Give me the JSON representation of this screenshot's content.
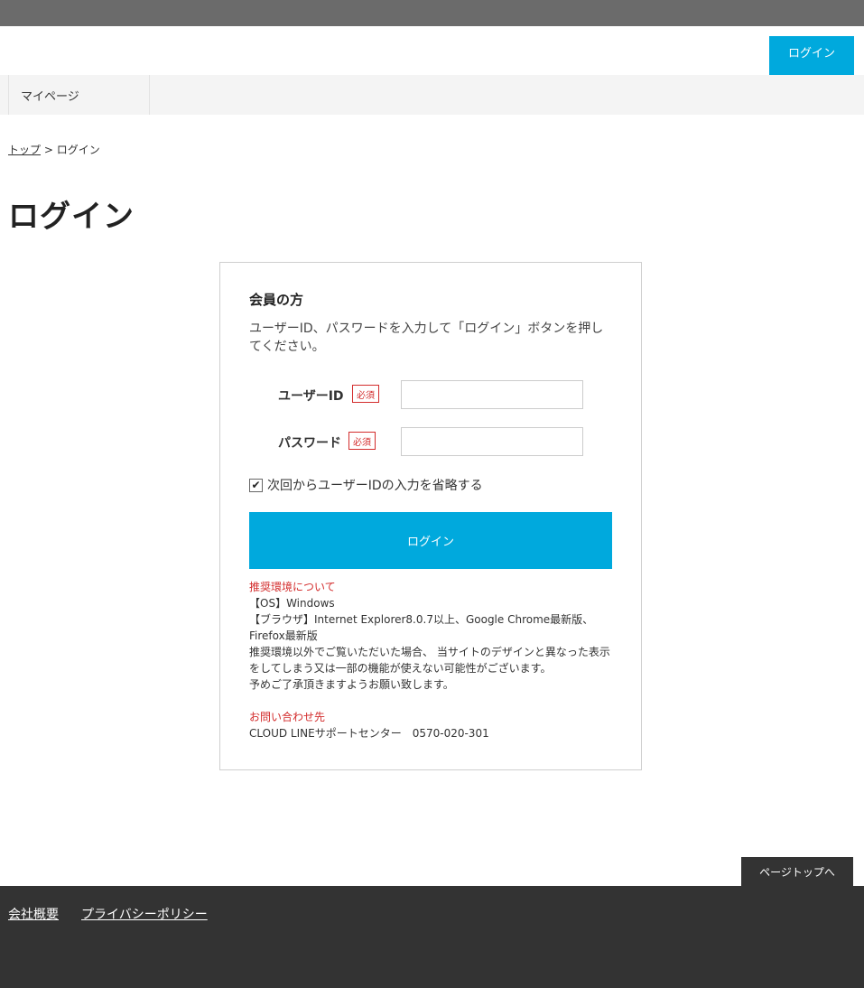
{
  "header": {
    "login_button": "ログイン"
  },
  "nav": {
    "items": [
      {
        "label": "マイページ"
      }
    ]
  },
  "breadcrumb": {
    "home": "トップ",
    "separator": ">",
    "current": "ログイン"
  },
  "page": {
    "title": "ログイン"
  },
  "login_form": {
    "heading": "会員の方",
    "description": "ユーザーID、パスワードを入力して「ログイン」ボタンを押してください。",
    "user_id": {
      "label": "ユーザーID",
      "required": "必須",
      "value": ""
    },
    "password": {
      "label": "パスワード",
      "required": "必須",
      "value": ""
    },
    "remember": {
      "label": "次回からユーザーIDの入力を省略する",
      "checked": true
    },
    "submit_label": "ログイン"
  },
  "environment": {
    "title": "推奨環境について",
    "os": "【OS】Windows",
    "browser": "【ブラウザ】Internet Explorer8.0.7以上、Google Chrome最新版、Firefox最新版",
    "note1": "推奨環境以外でご覧いただいた場合、 当サイトのデザインと異なった表示をしてしまう又は一部の機能が使えない可能性がございます。",
    "note2": "予めご了承頂きますようお願い致します。"
  },
  "contact": {
    "title": "お問い合わせ先",
    "text": "CLOUD LINEサポートセンター　0570-020-301"
  },
  "page_top_label": "ページトップへ",
  "footer": {
    "links": [
      {
        "label": "会社概要"
      },
      {
        "label": "プライバシーポリシー"
      }
    ]
  },
  "colors": {
    "accent": "#00a9dd",
    "required": "#d32c2c",
    "footer": "#333333"
  }
}
